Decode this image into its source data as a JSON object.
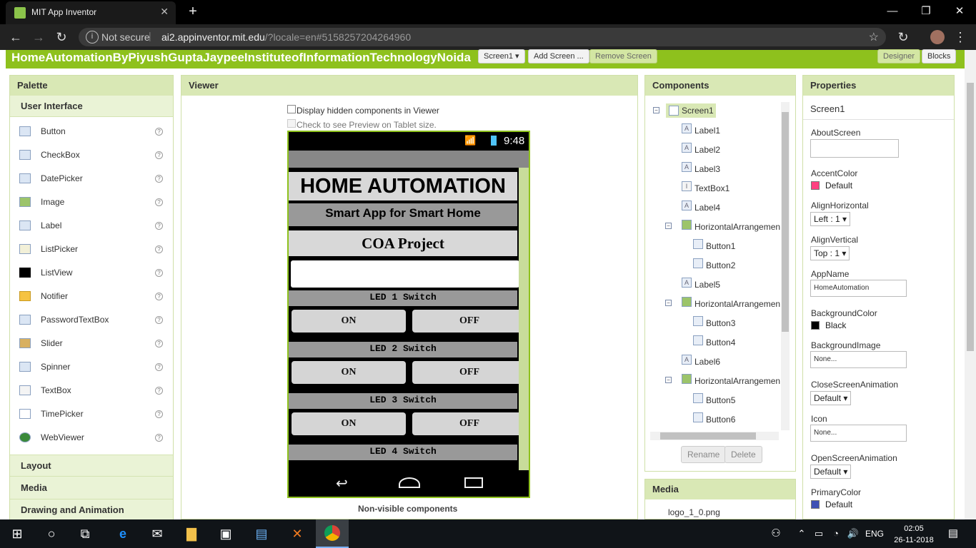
{
  "browser": {
    "tab_title": "MIT App Inventor",
    "new_tab": "+",
    "security_label": "Not secure",
    "url_host": "ai2.appinventor.mit.edu",
    "url_path": "/?locale=en#5158257204264960"
  },
  "header": {
    "project_name": "HomeAutomationByPiyushGuptaJaypeeInstituteofInformationTechnologyNoida",
    "screen_select": "Screen1 ▾",
    "add_screen": "Add Screen ...",
    "remove_screen": "Remove Screen",
    "designer": "Designer",
    "blocks": "Blocks"
  },
  "palette": {
    "title": "Palette",
    "category": "User Interface",
    "items": [
      "Button",
      "CheckBox",
      "DatePicker",
      "Image",
      "Label",
      "ListPicker",
      "ListView",
      "Notifier",
      "PasswordTextBox",
      "Slider",
      "Spinner",
      "TextBox",
      "TimePicker",
      "WebViewer"
    ],
    "help": "?",
    "sections": [
      "Layout",
      "Media",
      "Drawing and Animation"
    ]
  },
  "viewer": {
    "title": "Viewer",
    "hidden_checkbox": "Display hidden components in Viewer",
    "tablet_checkbox": "Check to see Preview on Tablet size.",
    "non_visible": "Non-visible components",
    "phone": {
      "time": "9:48",
      "title": "HOME AUTOMATION",
      "subtitle": "Smart App for Smart Home",
      "project": "COA Project",
      "led1": "LED 1 Switch",
      "led2": "LED 2 Switch",
      "led3": "LED 3 Switch",
      "led4": "LED 4 Switch",
      "on": "ON",
      "off": "OFF"
    }
  },
  "components": {
    "title": "Components",
    "tree": [
      "Screen1",
      "Label1",
      "Label2",
      "Label3",
      "TextBox1",
      "Label4",
      "HorizontalArrangemen",
      "Button1",
      "Button2",
      "Label5",
      "HorizontalArrangemen",
      "Button3",
      "Button4",
      "Label6",
      "HorizontalArrangemen",
      "Button5",
      "Button6"
    ],
    "rename": "Rename",
    "delete": "Delete"
  },
  "media": {
    "title": "Media",
    "file": "logo_1_0.png"
  },
  "properties": {
    "title": "Properties",
    "component": "Screen1",
    "about_screen": "AboutScreen",
    "accent_color": "AccentColor",
    "accent_value": "Default",
    "align_h": "AlignHorizontal",
    "align_h_value": "Left : 1 ▾",
    "align_v": "AlignVertical",
    "align_v_value": "Top : 1 ▾",
    "app_name": "AppName",
    "app_name_value": "HomeAutomation",
    "bg_color": "BackgroundColor",
    "bg_color_value": "Black",
    "bg_image": "BackgroundImage",
    "bg_image_value": "None...",
    "close_anim": "CloseScreenAnimation",
    "close_anim_value": "Default ▾",
    "icon": "Icon",
    "icon_value": "None...",
    "open_anim": "OpenScreenAnimation",
    "open_anim_value": "Default ▾",
    "primary_color": "PrimaryColor",
    "primary_value": "Default"
  },
  "colors": {
    "accent": "#ff4081",
    "primary": "#3f51b5",
    "bg": "#000000",
    "brand": "#8ec11d"
  },
  "taskbar": {
    "lang": "ENG",
    "time": "02:05",
    "date": "26-11-2018"
  }
}
